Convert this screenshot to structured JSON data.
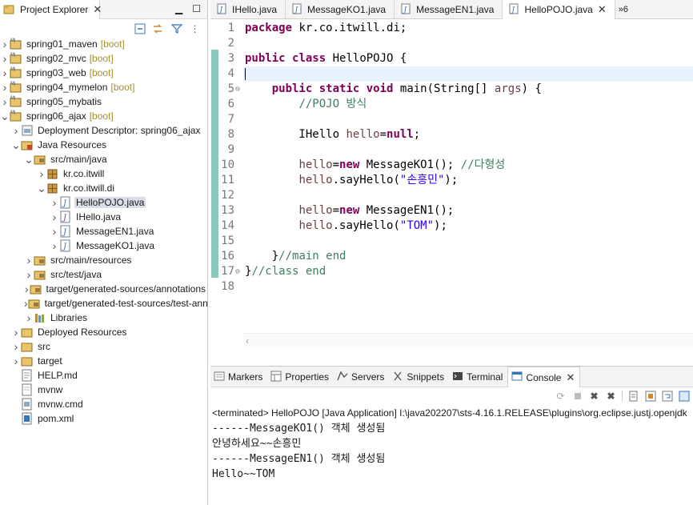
{
  "explorer": {
    "title": "Project Explorer",
    "tree": [
      {
        "indent": 0,
        "chev": ">",
        "icon": "maven-project-icon",
        "label": "spring01_maven",
        "suffix": "[boot]"
      },
      {
        "indent": 0,
        "chev": ">",
        "icon": "maven-project-icon",
        "label": "spring02_mvc",
        "suffix": "[boot]"
      },
      {
        "indent": 0,
        "chev": ">",
        "icon": "maven-project-icon",
        "label": "spring03_web",
        "suffix": "[boot]"
      },
      {
        "indent": 0,
        "chev": ">",
        "icon": "maven-project-icon",
        "label": "spring04_mymelon",
        "suffix": "[boot]"
      },
      {
        "indent": 0,
        "chev": ">",
        "icon": "maven-project-icon",
        "label": "spring05_mybatis",
        "suffix": ""
      },
      {
        "indent": 0,
        "chev": "v",
        "icon": "maven-project-icon",
        "label": "spring06_ajax",
        "suffix": "[boot]"
      },
      {
        "indent": 1,
        "chev": ">",
        "icon": "deployment-descriptor-icon",
        "label": "Deployment Descriptor: spring06_ajax",
        "suffix": ""
      },
      {
        "indent": 1,
        "chev": "v",
        "icon": "java-resources-icon",
        "label": "Java Resources",
        "suffix": ""
      },
      {
        "indent": 2,
        "chev": "v",
        "icon": "source-folder-icon",
        "label": "src/main/java",
        "suffix": ""
      },
      {
        "indent": 3,
        "chev": ">",
        "icon": "package-icon",
        "label": "kr.co.itwill",
        "suffix": ""
      },
      {
        "indent": 3,
        "chev": "v",
        "icon": "package-icon",
        "label": "kr.co.itwill.di",
        "suffix": ""
      },
      {
        "indent": 4,
        "chev": ">",
        "icon": "java-file-icon",
        "label": "HelloPOJO.java",
        "suffix": "",
        "selected": true
      },
      {
        "indent": 4,
        "chev": ">",
        "icon": "interface-file-icon",
        "label": "IHello.java",
        "suffix": ""
      },
      {
        "indent": 4,
        "chev": ">",
        "icon": "java-file-icon",
        "label": "MessageEN1.java",
        "suffix": ""
      },
      {
        "indent": 4,
        "chev": ">",
        "icon": "java-file-icon",
        "label": "MessageKO1.java",
        "suffix": ""
      },
      {
        "indent": 2,
        "chev": ">",
        "icon": "source-folder-icon",
        "label": "src/main/resources",
        "suffix": ""
      },
      {
        "indent": 2,
        "chev": ">",
        "icon": "source-folder-icon",
        "label": "src/test/java",
        "suffix": ""
      },
      {
        "indent": 2,
        "chev": ">",
        "icon": "source-folder-icon",
        "label": "target/generated-sources/annotations",
        "suffix": ""
      },
      {
        "indent": 2,
        "chev": ">",
        "icon": "source-folder-icon",
        "label": "target/generated-test-sources/test-annotations",
        "suffix": ""
      },
      {
        "indent": 2,
        "chev": ">",
        "icon": "libraries-icon",
        "label": "Libraries",
        "suffix": ""
      },
      {
        "indent": 1,
        "chev": ">",
        "icon": "deployed-resources-icon",
        "label": "Deployed Resources",
        "suffix": ""
      },
      {
        "indent": 1,
        "chev": ">",
        "icon": "folder-icon",
        "label": "src",
        "suffix": ""
      },
      {
        "indent": 1,
        "chev": ">",
        "icon": "folder-icon",
        "label": "target",
        "suffix": ""
      },
      {
        "indent": 1,
        "chev": "",
        "icon": "markdown-file-icon",
        "label": "HELP.md",
        "suffix": ""
      },
      {
        "indent": 1,
        "chev": "",
        "icon": "text-file-icon",
        "label": "mvnw",
        "suffix": ""
      },
      {
        "indent": 1,
        "chev": "",
        "icon": "cmd-file-icon",
        "label": "mvnw.cmd",
        "suffix": ""
      },
      {
        "indent": 1,
        "chev": "",
        "icon": "xml-file-icon",
        "label": "pom.xml",
        "suffix": ""
      }
    ]
  },
  "editor": {
    "tabs": [
      {
        "label": "IHello.java",
        "active": false
      },
      {
        "label": "MessageKO1.java",
        "active": false
      },
      {
        "label": "MessageEN1.java",
        "active": false
      },
      {
        "label": "HelloPOJO.java",
        "active": true
      }
    ],
    "more_tabs": "»6",
    "lines": [
      {
        "n": "1",
        "tokens": [
          [
            "kw",
            "package"
          ],
          [
            "t",
            " kr.co.itwill.di;"
          ]
        ]
      },
      {
        "n": "2",
        "tokens": []
      },
      {
        "n": "3",
        "tokens": [
          [
            "kw",
            "public"
          ],
          [
            "t",
            " "
          ],
          [
            "kw",
            "class"
          ],
          [
            "t",
            " HelloPOJO {"
          ]
        ]
      },
      {
        "n": "4",
        "tokens": [],
        "current": true
      },
      {
        "n": "5",
        "fold": true,
        "tokens": [
          [
            "t",
            "    "
          ],
          [
            "kw",
            "public"
          ],
          [
            "t",
            " "
          ],
          [
            "kw",
            "static"
          ],
          [
            "t",
            " "
          ],
          [
            "kw",
            "void"
          ],
          [
            "t",
            " main(String[] "
          ],
          [
            "var",
            "args"
          ],
          [
            "t",
            ") {"
          ]
        ]
      },
      {
        "n": "6",
        "tokens": [
          [
            "t",
            "        "
          ],
          [
            "cm",
            "//POJO 방식"
          ]
        ]
      },
      {
        "n": "7",
        "tokens": []
      },
      {
        "n": "8",
        "tokens": [
          [
            "t",
            "        IHello "
          ],
          [
            "var",
            "hello"
          ],
          [
            "t",
            "="
          ],
          [
            "kw",
            "null"
          ],
          [
            "t",
            ";"
          ]
        ]
      },
      {
        "n": "9",
        "tokens": []
      },
      {
        "n": "10",
        "tokens": [
          [
            "t",
            "        "
          ],
          [
            "var",
            "hello"
          ],
          [
            "t",
            "="
          ],
          [
            "kw",
            "new"
          ],
          [
            "t",
            " MessageKO1(); "
          ],
          [
            "cm",
            "//다형성"
          ]
        ]
      },
      {
        "n": "11",
        "tokens": [
          [
            "t",
            "        "
          ],
          [
            "var",
            "hello"
          ],
          [
            "t",
            ".sayHello("
          ],
          [
            "str",
            "\"손흥민\""
          ],
          [
            "t",
            ");"
          ]
        ]
      },
      {
        "n": "12",
        "tokens": []
      },
      {
        "n": "13",
        "tokens": [
          [
            "t",
            "        "
          ],
          [
            "var",
            "hello"
          ],
          [
            "t",
            "="
          ],
          [
            "kw",
            "new"
          ],
          [
            "t",
            " MessageEN1();"
          ]
        ]
      },
      {
        "n": "14",
        "tokens": [
          [
            "t",
            "        "
          ],
          [
            "var",
            "hello"
          ],
          [
            "t",
            ".sayHello("
          ],
          [
            "str",
            "\"TOM\""
          ],
          [
            "t",
            ");"
          ]
        ]
      },
      {
        "n": "15",
        "tokens": []
      },
      {
        "n": "16",
        "tokens": [
          [
            "t",
            "    }"
          ],
          [
            "cm",
            "//main end"
          ]
        ]
      },
      {
        "n": "17",
        "fold": true,
        "tokens": [
          [
            "t",
            "}"
          ],
          [
            "cm",
            "//class end"
          ]
        ]
      },
      {
        "n": "18",
        "tokens": []
      }
    ]
  },
  "bottom": {
    "tabs": [
      {
        "label": "Markers",
        "icon": "markers-icon",
        "active": false
      },
      {
        "label": "Properties",
        "icon": "properties-icon",
        "active": false
      },
      {
        "label": "Servers",
        "icon": "servers-icon",
        "active": false
      },
      {
        "label": "Snippets",
        "icon": "snippets-icon",
        "active": false
      },
      {
        "label": "Terminal",
        "icon": "terminal-icon",
        "active": false
      },
      {
        "label": "Console",
        "icon": "console-icon",
        "active": true
      }
    ],
    "status": "<terminated> HelloPOJO [Java Application] I:\\java202207\\sts-4.16.1.RELEASE\\plugins\\org.eclipse.justj.openjdk",
    "output": [
      "------MessageKO1() 객체 생성됨",
      "안녕하세요~~손흥민",
      "------MessageEN1() 객체 생성됨",
      "Hello~~TOM"
    ]
  },
  "colors": {
    "keyword": "#7f0055",
    "comment": "#3f7f5f",
    "string": "#2a00ff",
    "variable": "#6a3e3e",
    "boot": "#a58f2e"
  }
}
